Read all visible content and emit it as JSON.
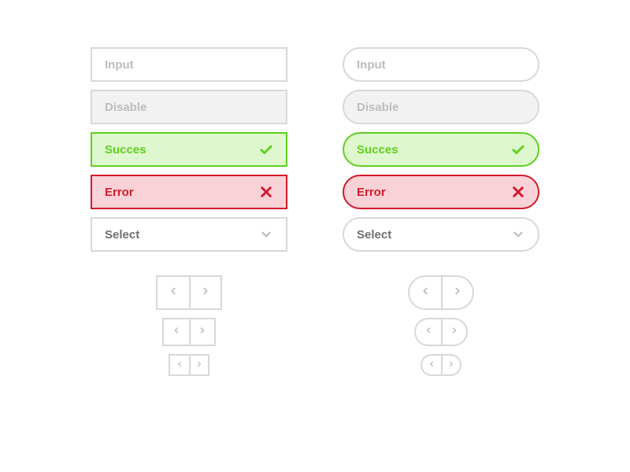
{
  "colors": {
    "border_default": "#d8d8d8",
    "text_muted": "#bdbdbd",
    "disable_bg": "#f2f2f2",
    "success_border": "#5fcf20",
    "success_bg": "#dff7cf",
    "error_border": "#d21a2d",
    "error_bg": "#f9d2d7"
  },
  "variants": {
    "left": "sharp",
    "right": "rounded"
  },
  "fields": {
    "input": {
      "placeholder": "Input"
    },
    "disable": {
      "placeholder": "Disable"
    },
    "success": {
      "placeholder": "Succes",
      "icon": "check-icon"
    },
    "error": {
      "placeholder": "Error",
      "icon": "close-icon"
    },
    "select": {
      "placeholder": "Select",
      "icon": "chevron-down-icon"
    }
  },
  "steppers": {
    "sizes": [
      "lg",
      "md",
      "sm"
    ],
    "prev_icon": "chevron-left-icon",
    "next_icon": "chevron-right-icon"
  }
}
